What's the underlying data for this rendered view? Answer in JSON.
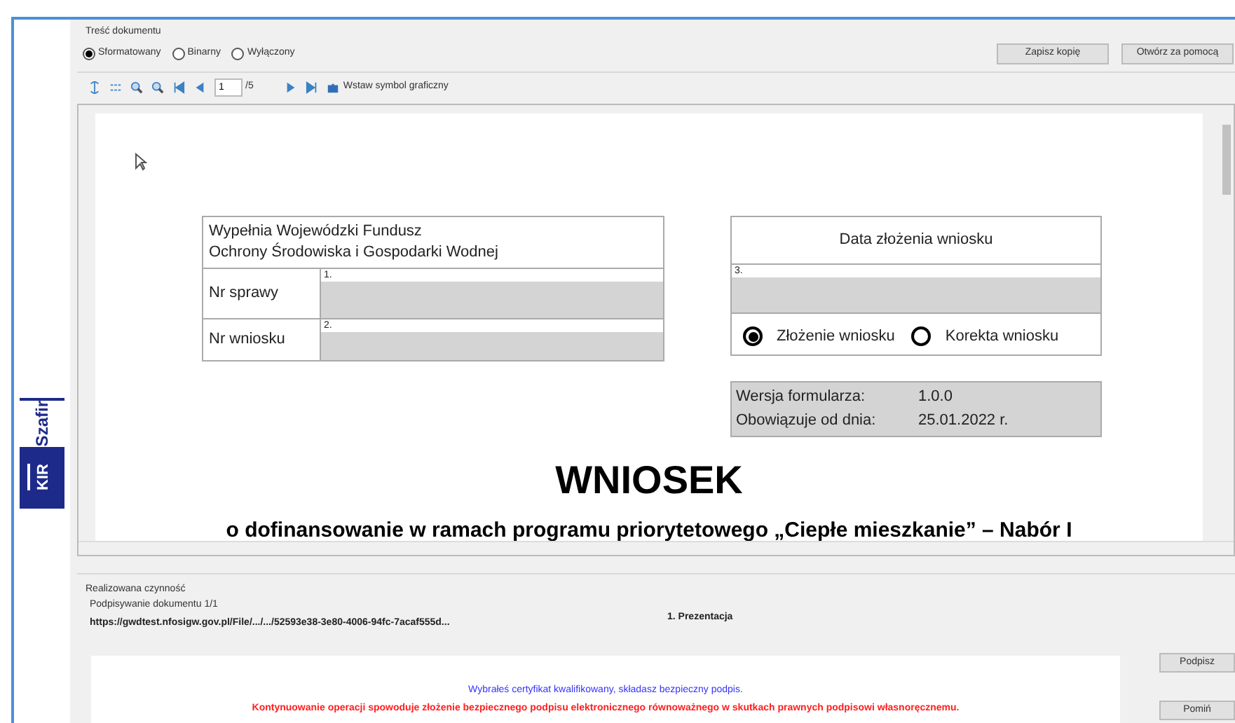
{
  "sidebar": {
    "logo_text": "Szafir",
    "logo_badge": "KIR"
  },
  "content_group": {
    "title": "Treść dokumentu",
    "modes": [
      {
        "label": "Sformatowany",
        "selected": true
      },
      {
        "label": "Binarny",
        "selected": false
      },
      {
        "label": "Wyłączony",
        "selected": false
      }
    ],
    "buttons": [
      "Zapisz kopię",
      "Otwórz za pomocą"
    ]
  },
  "toolbar": {
    "page": "1",
    "page_count": "/5",
    "insert_label": "Wstaw symbol graficzny"
  },
  "document": {
    "left_table": {
      "header": [
        "Wypełnia Wojewódzki Fundusz",
        "Ochrony Środowiska i Gospodarki Wodnej"
      ],
      "rows": [
        {
          "label": "Nr sprawy",
          "number": "1."
        },
        {
          "label": "Nr wniosku",
          "number": "2."
        }
      ]
    },
    "right_table": {
      "header": "Data złożenia wniosku",
      "number": "3.",
      "options": [
        {
          "label": "Złożenie wniosku",
          "selected": true
        },
        {
          "label": "Korekta wniosku",
          "selected": false
        }
      ]
    },
    "version": [
      {
        "label": "Wersja formularza:",
        "value": "1.0.0"
      },
      {
        "label": "Obowiązuje od dnia:",
        "value": "25.01.2022 r."
      }
    ],
    "title": "WNIOSEK",
    "subtitle": "o dofinansowanie w ramach programu priorytetowego „Ciepłe mieszkanie” – Nabór I"
  },
  "action_group": {
    "title": "Realizowana czynność",
    "step": "Podpisywanie dokumentu 1/1",
    "url": "https://gwdtest.nfosigw.gov.pl/File/.../.../52593e38-3e80-4006-94fc-7acaf555d...",
    "stage": "1. Prezentacja",
    "info": "Wybrałeś certyfikat kwalifikowany, składasz bezpieczny podpis.",
    "warning": "Kontynuowanie operacji spowoduje złożenie bezpiecznego podpisu elektronicznego równoważnego w skutkach prawnych podpisowi własnoręcznemu.",
    "buttons": [
      "Podpisz",
      "Pomiń"
    ]
  }
}
